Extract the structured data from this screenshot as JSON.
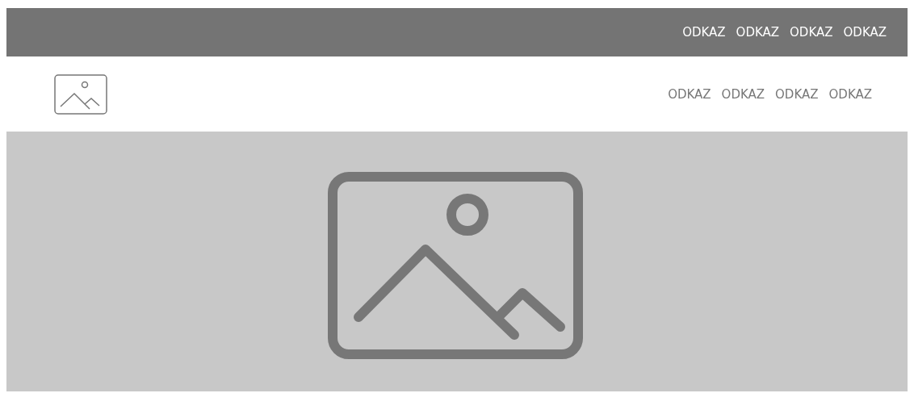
{
  "top_bar": {
    "links": [
      "ODKAZ",
      "ODKAZ",
      "ODKAZ",
      "ODKAZ"
    ]
  },
  "header": {
    "links": [
      "ODKAZ",
      "ODKAZ",
      "ODKAZ",
      "ODKAZ"
    ]
  },
  "hero": {
    "kind": "image-placeholder"
  }
}
